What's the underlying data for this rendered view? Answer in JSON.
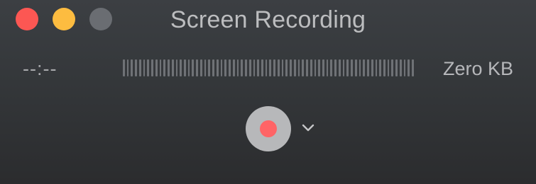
{
  "window": {
    "title": "Screen Recording",
    "controls": [
      "close",
      "minimize",
      "zoom"
    ]
  },
  "status": {
    "elapsed_time": "--:--",
    "file_size": "Zero KB"
  },
  "audio_meter": {
    "level": 0,
    "segments": 72
  },
  "actions": {
    "record_icon": "record-icon",
    "options_icon": "chevron-down-icon"
  },
  "colors": {
    "close": "#fc5753",
    "minimize": "#fdbc40",
    "zoom": "#6a6d72",
    "record": "#ff6466"
  }
}
